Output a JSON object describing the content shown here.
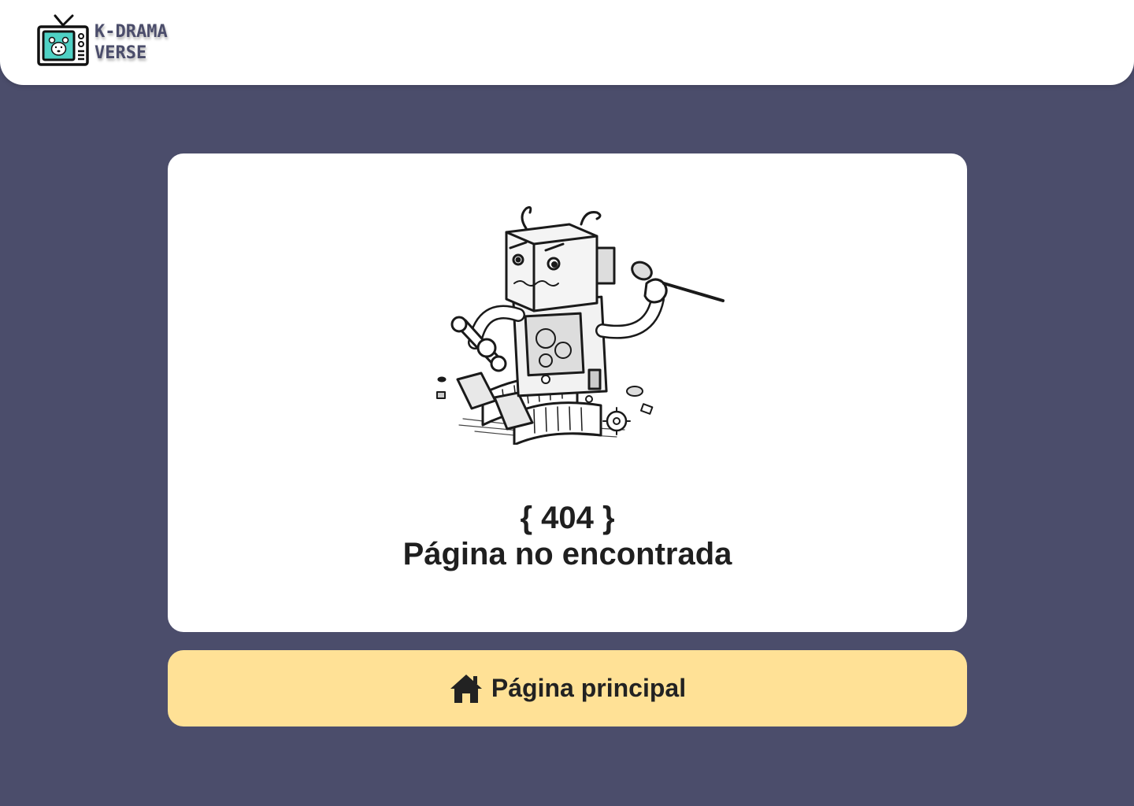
{
  "header": {
    "logo_line1": "K-DRAMA",
    "logo_line2": "VERSE",
    "logo_icon": "tv-icon"
  },
  "error": {
    "code": "{ 404 }",
    "message": "Página no encontrada",
    "illustration": "broken-robot"
  },
  "actions": {
    "home_label": "Página principal",
    "home_icon": "home-icon"
  },
  "colors": {
    "background": "#4b4d6b",
    "header": "#ffffff",
    "card": "#ffffff",
    "button": "#ffe196",
    "logo_accent": "#4fd1c5",
    "logo_text": "#4b4d6b"
  }
}
